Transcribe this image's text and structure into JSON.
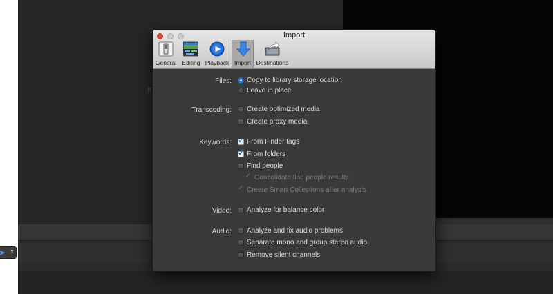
{
  "background": {
    "viewer_fragment": "Ir"
  },
  "dialog": {
    "title": "Import",
    "tabs": [
      {
        "label": "General",
        "icon": "general-switch-icon",
        "selected": false
      },
      {
        "label": "Editing",
        "icon": "editing-timeline-icon",
        "selected": false
      },
      {
        "label": "Playback",
        "icon": "playback-play-icon",
        "selected": false
      },
      {
        "label": "Import",
        "icon": "import-arrow-icon",
        "selected": true
      },
      {
        "label": "Destinations",
        "icon": "destinations-share-icon",
        "selected": false
      }
    ],
    "sections": {
      "files": {
        "label": "Files:",
        "options": [
          {
            "label": "Copy to library storage location",
            "checked": true
          },
          {
            "label": "Leave in place",
            "checked": false
          }
        ]
      },
      "transcoding": {
        "label": "Transcoding:",
        "options": [
          {
            "label": "Create optimized media",
            "checked": false
          },
          {
            "label": "Create proxy media",
            "checked": false
          }
        ]
      },
      "keywords": {
        "label": "Keywords:",
        "options": [
          {
            "label": "From Finder tags",
            "checked": true,
            "enabled": true
          },
          {
            "label": "From folders",
            "checked": true,
            "enabled": true
          },
          {
            "label": "Find people",
            "checked": false,
            "enabled": true
          },
          {
            "label": "Consolidate find people results",
            "checked": true,
            "enabled": false
          },
          {
            "label": "Create Smart Collections after analysis",
            "checked": true,
            "enabled": false
          }
        ]
      },
      "video": {
        "label": "Video:",
        "options": [
          {
            "label": "Analyze for balance color",
            "checked": false
          }
        ]
      },
      "audio": {
        "label": "Audio:",
        "options": [
          {
            "label": "Analyze and fix audio problems",
            "checked": false
          },
          {
            "label": "Separate mono and group stereo audio",
            "checked": false
          },
          {
            "label": "Remove silent channels",
            "checked": false
          }
        ]
      }
    }
  },
  "colors": {
    "accent": "#2f7fe2",
    "close_button": "#e0443e",
    "dialog_bg": "#3a3a3a"
  }
}
